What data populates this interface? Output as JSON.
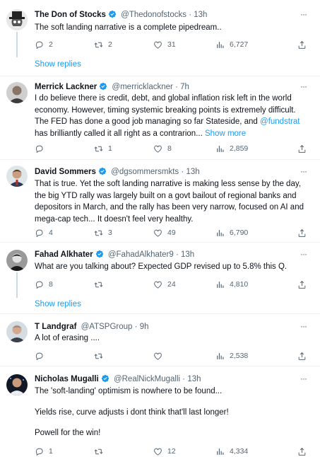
{
  "tweets": [
    {
      "name": "The Don of Stocks",
      "handle": "@Thedonofstocks",
      "time": "13h",
      "text": "The soft landing narrative is a complete pipedream..",
      "replies": "2",
      "retweets": "2",
      "likes": "31",
      "views": "6,727",
      "show_replies": "Show replies"
    },
    {
      "name": "Merrick Lackner",
      "handle": "@merricklackner",
      "time": "7h",
      "text": "I do believe there is credit, debt, and global inflation risk left in the world economy. However, timing systemic breaking points is extremely difficult. The FED has done a good job managing so far Stateside, and ",
      "mention": "@fundstrat",
      "text_after": " has brilliantly called it all right as a contrarion... ",
      "show_more": "Show more",
      "replies": "",
      "retweets": "1",
      "likes": "8",
      "views": "2,859"
    },
    {
      "name": "David Sommers",
      "handle": "@dgsommersmkts",
      "time": "13h",
      "text": "That is true. Yet the soft landing narrative is making less sense by the day, the big YTD rally was largely built on a govt bailout of regional banks and depositors in March, and the rally has been very narrow, focused on AI and mega-cap tech... It doesn't feel very healthy.",
      "replies": "4",
      "retweets": "3",
      "likes": "49",
      "views": "6,790"
    },
    {
      "name": "Fahad Alkhater",
      "handle": "@FahadAlkhater9",
      "time": "13h",
      "text": "What are you talking about? Expected GDP revised up to 5.8% this Q.",
      "replies": "8",
      "retweets": "",
      "likes": "24",
      "views": "4,810",
      "show_replies": "Show replies"
    },
    {
      "name": "T Landgraf",
      "handle": "@ATSPGroup",
      "time": "9h",
      "text": "A lot of erasing ....",
      "replies": "",
      "retweets": "",
      "likes": "",
      "views": "2,538"
    },
    {
      "name": "Nicholas Mugalli",
      "handle": "@RealNickMugalli",
      "time": "13h",
      "text": "The 'soft-landing' optimism is nowhere to be found...",
      "text2": "Yields rise, curve adjusts i dont think that'll last longer!",
      "text3": "Powell for the win!",
      "replies": "1",
      "retweets": "",
      "likes": "12",
      "views": "4,334"
    }
  ],
  "colors": {
    "verified": "#1d9bf0",
    "link": "#1d9bf0",
    "muted": "#536471",
    "separator": "#eff3f4"
  },
  "icons": [
    "more-icon",
    "verified-badge-icon",
    "reply-icon",
    "retweet-icon",
    "like-icon",
    "views-icon",
    "share-icon"
  ]
}
